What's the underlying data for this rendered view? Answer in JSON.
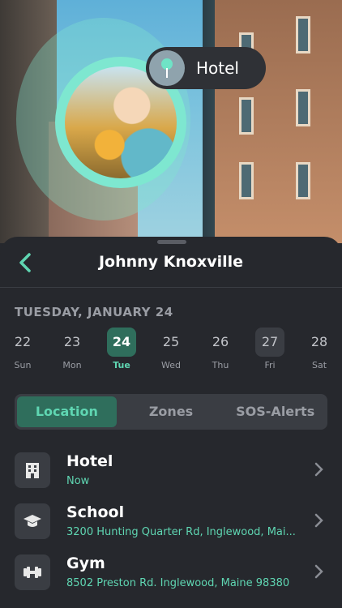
{
  "map": {
    "pin_label": "Hotel"
  },
  "header": {
    "title": "Johnny Knoxville"
  },
  "date_label": "TUESDAY, JANUARY 24",
  "days": [
    {
      "num": "22",
      "wd": "Sun"
    },
    {
      "num": "23",
      "wd": "Mon"
    },
    {
      "num": "24",
      "wd": "Tue"
    },
    {
      "num": "25",
      "wd": "Wed"
    },
    {
      "num": "26",
      "wd": "Thu"
    },
    {
      "num": "27",
      "wd": "Fri"
    },
    {
      "num": "28",
      "wd": "Sat"
    }
  ],
  "tabs": [
    {
      "label": "Location"
    },
    {
      "label": "Zones"
    },
    {
      "label": "SOS-Alerts"
    }
  ],
  "places": [
    {
      "name": "Hotel",
      "sub": "Now",
      "icon": "building-icon"
    },
    {
      "name": "School",
      "sub": "3200 Hunting Quarter Rd, Inglewood, Mai...",
      "icon": "graduation-cap-icon"
    },
    {
      "name": "Gym",
      "sub": "8502 Preston Rd. Inglewood, Maine 98380",
      "icon": "dumbbell-icon"
    }
  ],
  "colors": {
    "accent": "#5fd6b2",
    "accent_bg": "#2f6e5c",
    "background": "#26282d"
  }
}
